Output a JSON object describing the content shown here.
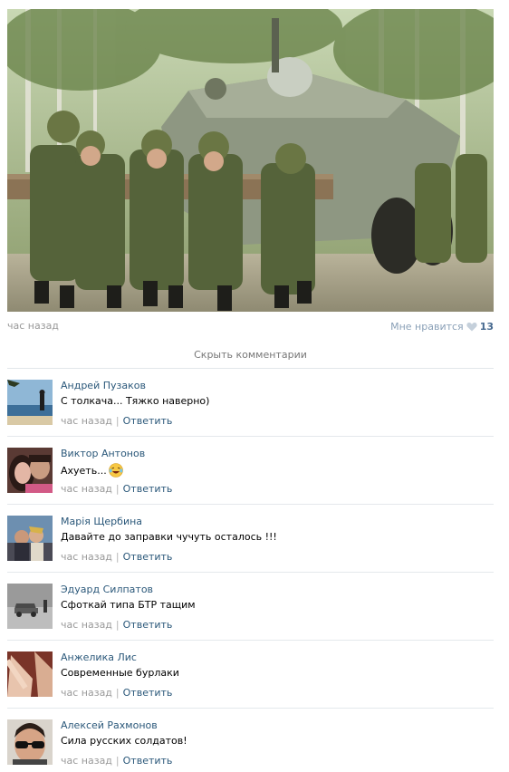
{
  "post": {
    "time": "час назад",
    "like_label": "Мне нравится",
    "like_count": "13",
    "heart_icon": "heart-icon"
  },
  "hide_comments_label": "Скрыть комментарии",
  "reply_label": "Ответить",
  "separator": "|",
  "comments": [
    {
      "author": "Андрей Пузаков",
      "text": "С толкача... Тяжко наверно)",
      "time": "час назад"
    },
    {
      "author": "Виктор Антонов",
      "text": "Ахуеть...",
      "emoji": "laughing-tears-emoji",
      "time": "час назад"
    },
    {
      "author": "Марія Щербина",
      "text": "Давайте до заправки чучуть осталось !!!",
      "time": "час назад"
    },
    {
      "author": "Эдуард Силпатов",
      "text": "Сфоткай типа БТР тащим",
      "time": "час назад"
    },
    {
      "author": "Анжелика Лис",
      "text": "Современные бурлаки",
      "time": "час назад"
    },
    {
      "author": "Алексей Рахмонов",
      "text": "Сила русских солдатов!",
      "time": "час назад"
    }
  ],
  "colors": {
    "link": "#2b587a",
    "muted": "#999999",
    "like_count": "#45688e"
  }
}
